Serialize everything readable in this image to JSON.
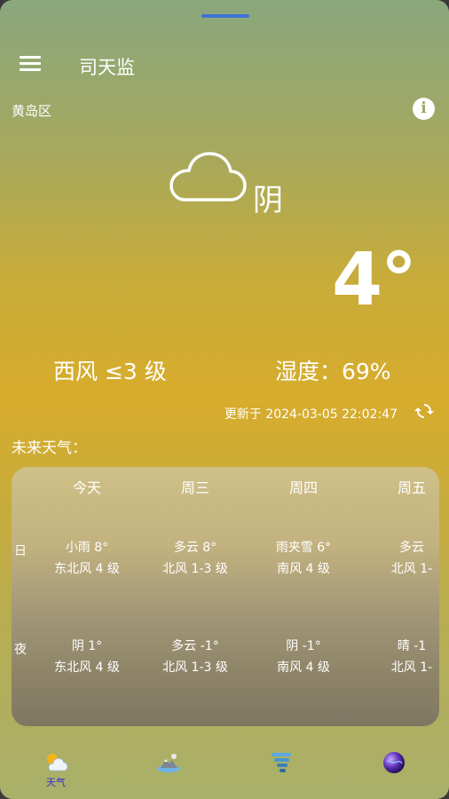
{
  "app": {
    "title": "司天监"
  },
  "location": {
    "district": "黄岛区"
  },
  "current": {
    "condition": "阴",
    "temperature": "4°",
    "wind": "西风 ≤3 级",
    "humidity": "湿度：69%",
    "updated": "更新于 2024-03-05 22:02:47"
  },
  "forecast": {
    "title": "未来天气：",
    "day_label": "日",
    "night_label": "夜",
    "columns": [
      {
        "day": "今天",
        "day_weather": "小雨 8°",
        "day_wind": "东北风 4 级",
        "night_weather": "阴 1°",
        "night_wind": "东北风 4 级"
      },
      {
        "day": "周三",
        "day_weather": "多云 8°",
        "day_wind": "北风 1-3 级",
        "night_weather": "多云 -1°",
        "night_wind": "北风 1-3 级"
      },
      {
        "day": "周四",
        "day_weather": "雨夹雪 6°",
        "day_wind": "南风 4 级",
        "night_weather": "阴 -1°",
        "night_wind": "南风 4 级"
      },
      {
        "day": "周五",
        "day_weather": "多云",
        "day_wind": "北风 1-",
        "night_weather": "晴 -1",
        "night_wind": "北风 1-"
      }
    ]
  },
  "nav": {
    "items": [
      {
        "label": "天气",
        "icon": "sun-cloud-icon",
        "active": true
      },
      {
        "label": "",
        "icon": "landscape-icon",
        "active": false
      },
      {
        "label": "",
        "icon": "tornado-icon",
        "active": false
      },
      {
        "label": "",
        "icon": "planet-icon",
        "active": false
      }
    ]
  },
  "colors": {
    "accent": "#3a2ad8",
    "handle": "#3c74d6"
  }
}
